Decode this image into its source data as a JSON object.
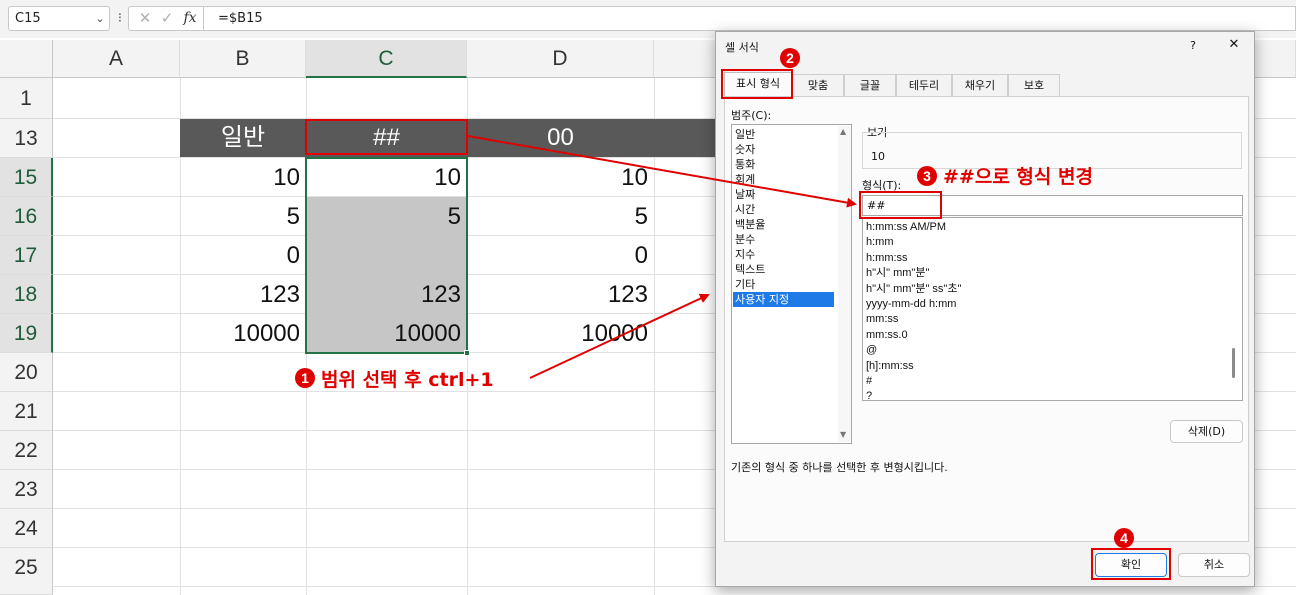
{
  "formula_bar": {
    "name_box": "C15",
    "name_box_arrow": "⌄",
    "more": "⁝",
    "icons": {
      "cancel": "✕",
      "enter": "✓",
      "function": "fx"
    },
    "formula": "=$B15"
  },
  "sheet": {
    "columns": [
      "A",
      "B",
      "C",
      "D"
    ],
    "rows": [
      "1",
      "13",
      "15",
      "16",
      "17",
      "18",
      "19",
      "20",
      "21",
      "22",
      "23",
      "24",
      "25"
    ],
    "header_row": {
      "b": "일반",
      "c": "##",
      "d": "00"
    },
    "col_b": [
      "10",
      "5",
      "0",
      "123",
      "10000"
    ],
    "col_c": [
      "10",
      "5",
      "",
      "123",
      "10000"
    ],
    "col_d": [
      "10",
      "5",
      "0",
      "123",
      "10000"
    ]
  },
  "dialog": {
    "title": "셀 서식",
    "help": "?",
    "close": "✕",
    "tabs": [
      "표시 형식",
      "맞춤",
      "글꼴",
      "테두리",
      "채우기",
      "보호"
    ],
    "category_label": "범주(C):",
    "categories": [
      "일반",
      "숫자",
      "통화",
      "회계",
      "날짜",
      "시간",
      "백분율",
      "분수",
      "지수",
      "텍스트",
      "기타",
      "사용자 지정"
    ],
    "selected_category": "사용자 지정",
    "sample_label": "보기",
    "sample_value": "10",
    "type_label": "형식(T):",
    "type_value": "##",
    "formats": [
      "h:mm:ss AM/PM",
      "h:mm",
      "h:mm:ss",
      "h\"시\" mm\"분\"",
      "h\"시\" mm\"분\" ss\"초\"",
      "yyyy-mm-dd h:mm",
      "mm:ss",
      "mm:ss.0",
      "@",
      "[h]:mm:ss",
      "#",
      "?"
    ],
    "delete_button": "삭제(D)",
    "description": "기존의 형식 중 하나를 선택한 후 변형시킵니다.",
    "ok_button": "확인",
    "cancel_button": "취소"
  },
  "annotations": {
    "step1_badge": "1",
    "step1_text": "범위 선택 후 ctrl+1",
    "step2_badge": "2",
    "step3_badge": "3",
    "step3_text": "##으로 형식 변경",
    "step4_badge": "4"
  },
  "colors": {
    "excel_green": "#217346",
    "header_fill": "#595959",
    "selection_fill": "#c6c6c6",
    "annotation_red": "#e00000",
    "listbox_selection": "#1e7ae6"
  }
}
